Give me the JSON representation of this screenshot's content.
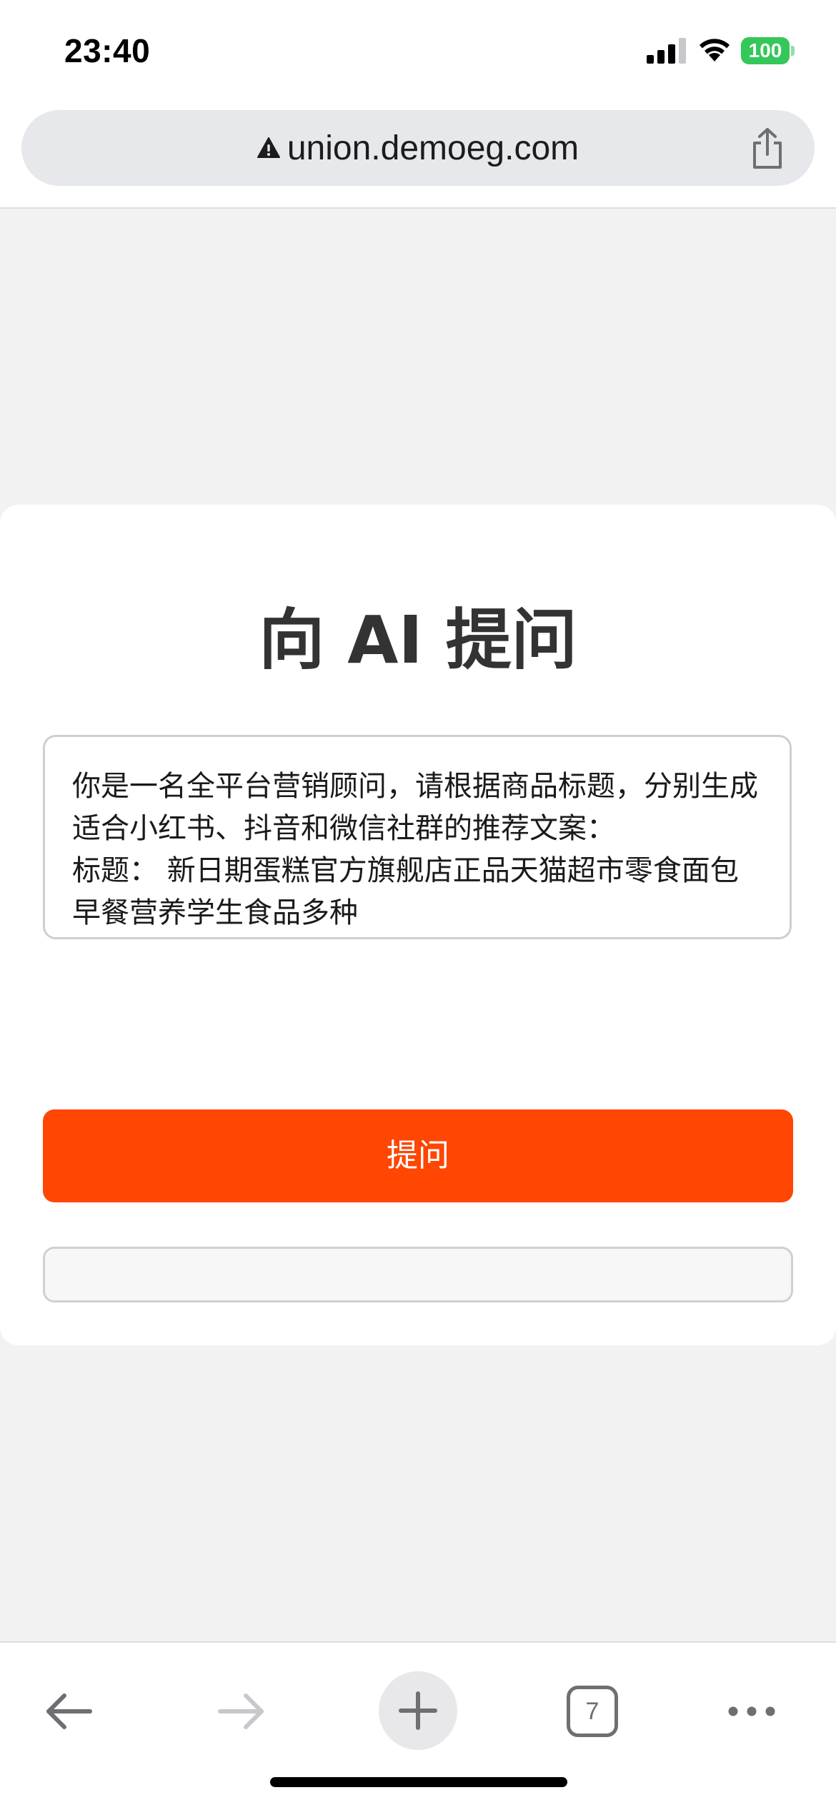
{
  "status_bar": {
    "time": "23:40",
    "battery": "100"
  },
  "browser": {
    "url": "union.demoeg.com",
    "tab_count": "7"
  },
  "page": {
    "title": "向 AI 提问",
    "prompt_text": "你是一名全平台营销顾问，请根据商品标题，分别生成适合小红书、抖音和微信社群的推荐文案：\n标题： 新日期蛋糕官方旗舰店正品天猫超市零食面包早餐营养学生食品多种\n要求：\n- **小红书**：突出颜值/生活方式，带“#”话题",
    "ask_button": "提问",
    "answer_text": ""
  },
  "colors": {
    "accent": "#ff4603",
    "battery": "#34c759",
    "title": "#333333"
  },
  "icons": {
    "security": "warning-icon",
    "share": "share-icon",
    "back": "arrow-left-icon",
    "forward": "arrow-right-icon",
    "new_tab": "plus-icon",
    "more": "more-dots-icon"
  }
}
